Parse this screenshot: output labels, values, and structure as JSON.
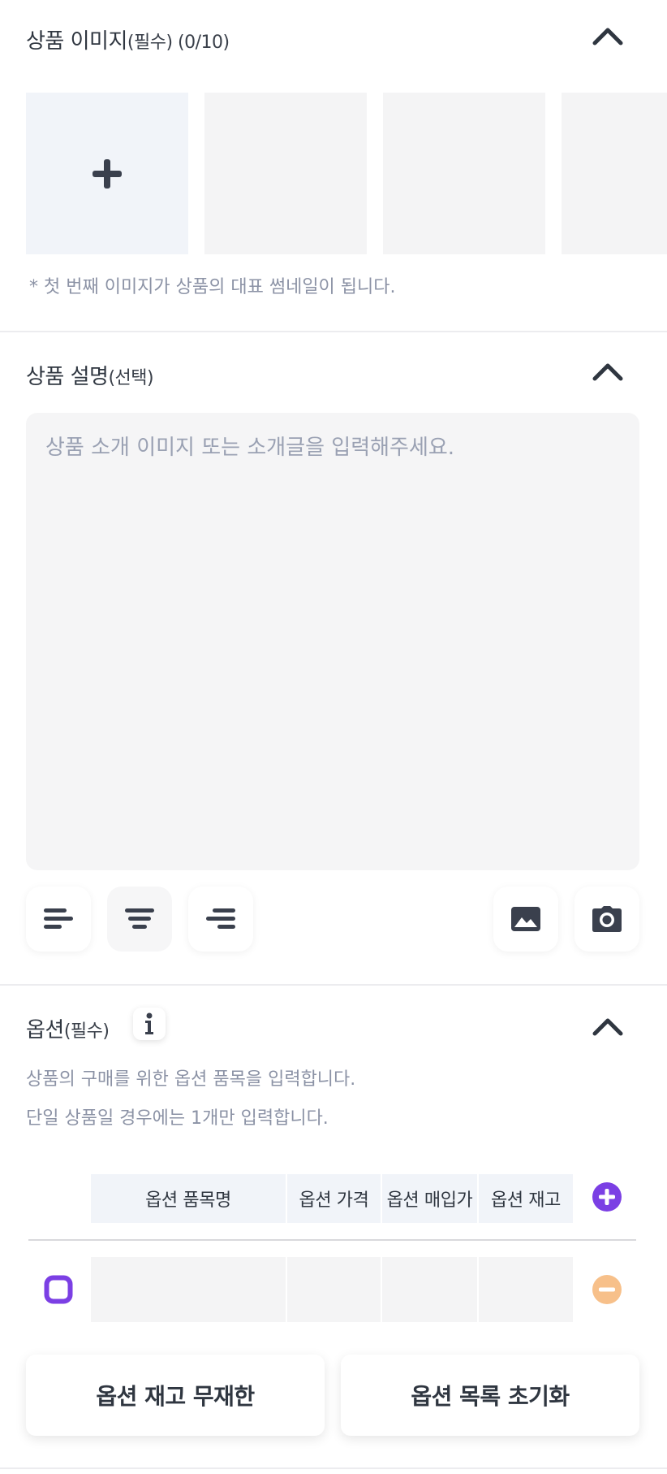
{
  "product_images": {
    "title": "상품 이미지",
    "subtitle": "(필수) (0/10)",
    "hint": "* 첫 번째 이미지가 상품의 대표 썸네일이 됩니다."
  },
  "product_description": {
    "title": "상품 설명",
    "subtitle": "(선택)",
    "placeholder": "상품 소개 이미지 또는 소개글을 입력해주세요."
  },
  "options": {
    "title": "옵션",
    "subtitle": "(필수)",
    "description_line1": "상품의 구매를 위한 옵션 품목을 입력합니다.",
    "description_line2": "단일 상품일 경우에는 1개만 입력합니다.",
    "columns": [
      "옵션 품목명",
      "옵션 가격",
      "옵션 매입가",
      "옵션 재고"
    ],
    "unlimited_stock_button": "옵션 재고 무재한",
    "reset_list_button": "옵션 목록 초기화"
  },
  "colors": {
    "accent": "#7b3fe4",
    "remove": "#f7c08a"
  }
}
